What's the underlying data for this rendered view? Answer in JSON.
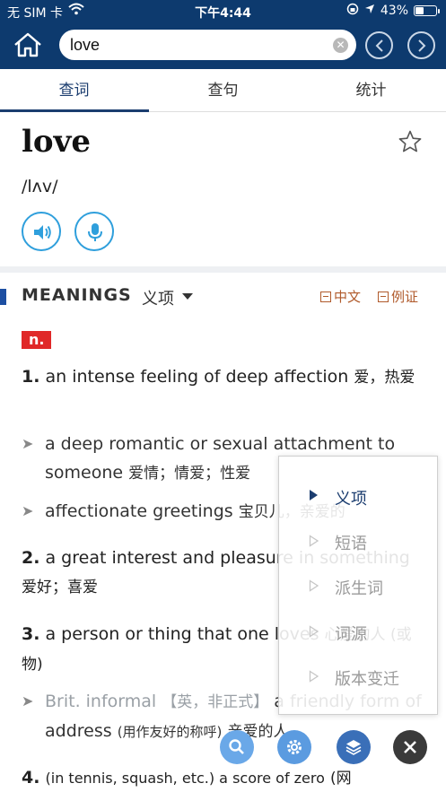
{
  "status": {
    "carrier": "无 SIM 卡",
    "time": "下午4:44",
    "battery": "43%",
    "battery_level": 0.43
  },
  "header": {
    "search_value": "love"
  },
  "tabs": [
    {
      "label": "查词",
      "active": true
    },
    {
      "label": "查句",
      "active": false
    },
    {
      "label": "统计",
      "active": false
    }
  ],
  "word": {
    "headword": "love",
    "phonetic": "/lʌv/"
  },
  "meanings": {
    "title": "MEANINGS",
    "subtitle": "义项",
    "toggle_chinese": "中文",
    "toggle_examples": "例证",
    "pos": "n."
  },
  "senses": [
    {
      "num": "1.",
      "en": "an intense feeling of deep affection",
      "zh": "爱，热爱"
    },
    {
      "num": "2.",
      "en": "a great interest and pleasure in something",
      "zh": "爱好；喜爱"
    },
    {
      "num": "3.",
      "en": "a person or thing that one loves",
      "zh": "心爱的人 (或物)"
    },
    {
      "num": "4.",
      "en": "(in tennis, squash, etc.) a score of zero",
      "zh": "(网"
    }
  ],
  "subsenses": [
    {
      "en": "a deep romantic or sexual attachment to someone",
      "zh": "爱情；情爱；性爱"
    },
    {
      "en": "affectionate greetings",
      "zh": "宝贝儿，亲爱的"
    },
    {
      "register": "Brit. informal",
      "register_zh": "【英，非正式】",
      "en": "a friendly form of address",
      "zh_paren": "(用作友好的称呼)",
      "zh": "亲爱的人"
    }
  ],
  "popup": {
    "items": [
      {
        "label": "义项",
        "active": true
      },
      {
        "label": "短语",
        "active": false
      },
      {
        "label": "派生词",
        "active": false
      },
      {
        "label": "词源",
        "active": false
      },
      {
        "label": "版本变迁",
        "active": false
      }
    ]
  },
  "colors": {
    "header_bg": "#0d3a6e",
    "accent": "#1b3d6f",
    "pos_tag": "#e02828",
    "toggle": "#b05a2b",
    "audio_blue": "#2f9fdc"
  },
  "icons": {
    "home": "home-icon",
    "clear": "clear-icon",
    "back": "chevron-left-icon",
    "forward": "chevron-right-icon",
    "star": "star-icon",
    "speaker": "speaker-icon",
    "mic": "microphone-icon",
    "search_fab": "search-icon",
    "settings_fab": "gear-icon",
    "layers_fab": "layers-icon",
    "close_fab": "close-icon"
  }
}
